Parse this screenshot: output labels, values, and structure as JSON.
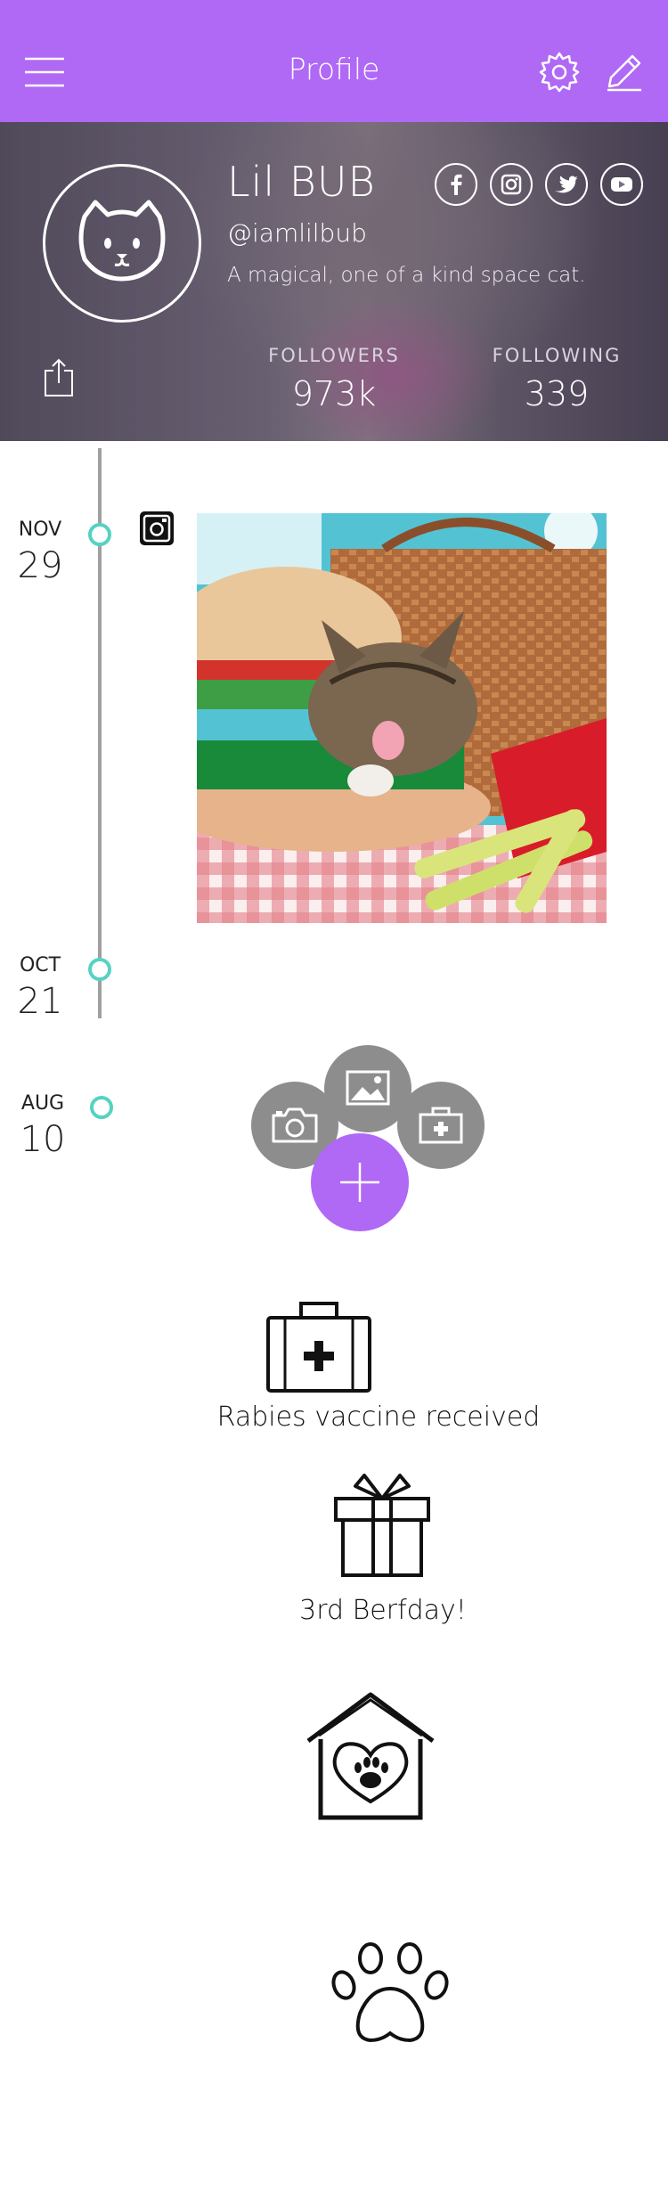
{
  "nav": {
    "title": "Profile",
    "icons": [
      "menu-icon",
      "settings-gear-icon",
      "edit-pencil-icon"
    ]
  },
  "profile": {
    "name": "Lil BUB",
    "handle": "@iamlilbub",
    "bio": "A magical, one of a kind space cat.",
    "avatar_icon": "cat-face-icon",
    "social_icons": [
      "facebook-icon",
      "instagram-icon",
      "twitter-icon",
      "youtube-icon"
    ],
    "stats": {
      "followers_label": "FOLLOWERS",
      "followers_value": "973k",
      "following_label": "FOLLOWING",
      "following_value": "339"
    }
  },
  "timeline": {
    "entries": [
      {
        "month": "NOV",
        "day": "29"
      },
      {
        "month": "OCT",
        "day": "21"
      },
      {
        "month": "AUG",
        "day": "10"
      }
    ]
  },
  "actions": {
    "sub_icons": [
      "camera-icon",
      "image-icon",
      "medical-kit-icon"
    ],
    "main_icon": "plus-icon"
  },
  "events": [
    {
      "icon": "medical-kit-icon",
      "label": "Rabies vaccine received"
    },
    {
      "icon": "gift-icon",
      "label": "3rd Berfday!"
    },
    {
      "icon": "pet-house-icon",
      "label": ""
    },
    {
      "icon": "paw-print-icon",
      "label": ""
    }
  ],
  "colors": {
    "accent": "#b069f5",
    "timeline_dot": "#56d2c2",
    "fab_secondary": "#8d8d8d"
  }
}
